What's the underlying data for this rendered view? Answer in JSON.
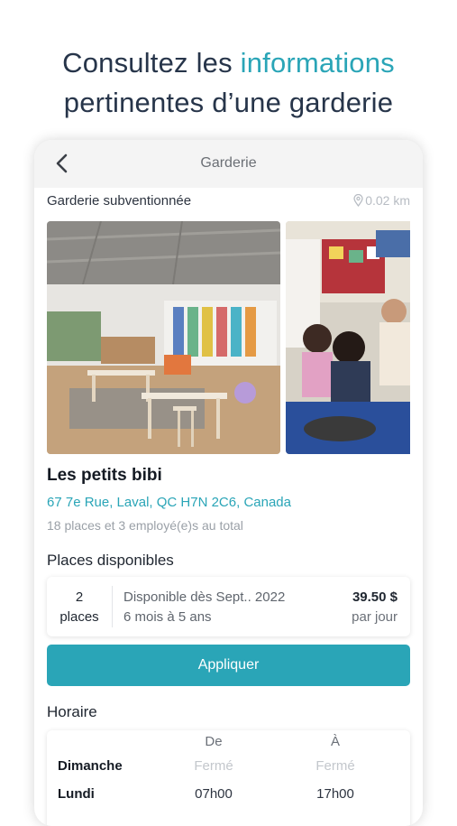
{
  "promo": {
    "line1_prefix": "Consultez les ",
    "line1_accent": "informations",
    "line2": "pertinentes d’une garderie"
  },
  "appbar": {
    "back_icon": "chevron-left-icon",
    "title": "Garderie"
  },
  "listing": {
    "type": "Garderie subventionnée",
    "distance": "0.02 km",
    "name": "Les petits bibi",
    "address": "67 7e Rue, Laval, QC H7N 2C6, Canada",
    "capacity": "18 places et 3 employé(e)s au total"
  },
  "places": {
    "section_title": "Places disponibles",
    "count": "2",
    "count_unit": "places",
    "availability": "Disponible dès Sept.. 2022",
    "age_range": "6 mois à 5 ans",
    "price": "39.50 $",
    "price_unit": "par jour"
  },
  "apply_label": "Appliquer",
  "schedule": {
    "section_title": "Horaire",
    "col_from": "De",
    "col_to": "À",
    "rows": [
      {
        "day": "Dimanche",
        "from": "Fermé",
        "to": "Fermé"
      },
      {
        "day": "Lundi",
        "from": "07h00",
        "to": "17h00"
      }
    ]
  },
  "colors": {
    "accent": "#2aa5b7",
    "headline": "#27354a"
  }
}
